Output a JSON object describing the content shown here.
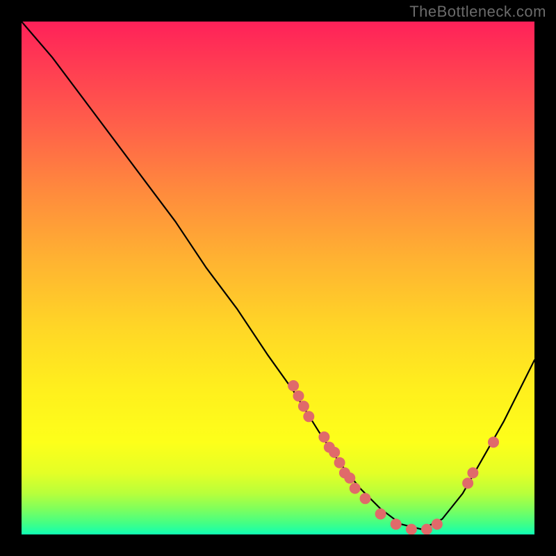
{
  "watermark": "TheBottleneck.com",
  "chart_data": {
    "type": "line",
    "title": "",
    "xlabel": "",
    "ylabel": "",
    "xlim": [
      0,
      100
    ],
    "ylim": [
      0,
      100
    ],
    "curve": [
      {
        "x": 0,
        "y": 100
      },
      {
        "x": 6,
        "y": 93
      },
      {
        "x": 12,
        "y": 85
      },
      {
        "x": 18,
        "y": 77
      },
      {
        "x": 24,
        "y": 69
      },
      {
        "x": 30,
        "y": 61
      },
      {
        "x": 36,
        "y": 52
      },
      {
        "x": 42,
        "y": 44
      },
      {
        "x": 48,
        "y": 35
      },
      {
        "x": 53,
        "y": 28
      },
      {
        "x": 58,
        "y": 20
      },
      {
        "x": 62,
        "y": 14
      },
      {
        "x": 66,
        "y": 9
      },
      {
        "x": 70,
        "y": 5
      },
      {
        "x": 74,
        "y": 2
      },
      {
        "x": 78,
        "y": 1
      },
      {
        "x": 82,
        "y": 3
      },
      {
        "x": 86,
        "y": 8
      },
      {
        "x": 90,
        "y": 15
      },
      {
        "x": 94,
        "y": 22
      },
      {
        "x": 98,
        "y": 30
      },
      {
        "x": 100,
        "y": 34
      }
    ],
    "scatter": [
      {
        "x": 53,
        "y": 29
      },
      {
        "x": 54,
        "y": 27
      },
      {
        "x": 55,
        "y": 25
      },
      {
        "x": 56,
        "y": 23
      },
      {
        "x": 59,
        "y": 19
      },
      {
        "x": 60,
        "y": 17
      },
      {
        "x": 61,
        "y": 16
      },
      {
        "x": 62,
        "y": 14
      },
      {
        "x": 63,
        "y": 12
      },
      {
        "x": 64,
        "y": 11
      },
      {
        "x": 65,
        "y": 9
      },
      {
        "x": 67,
        "y": 7
      },
      {
        "x": 70,
        "y": 4
      },
      {
        "x": 73,
        "y": 2
      },
      {
        "x": 76,
        "y": 1
      },
      {
        "x": 79,
        "y": 1
      },
      {
        "x": 81,
        "y": 2
      },
      {
        "x": 87,
        "y": 10
      },
      {
        "x": 88,
        "y": 12
      },
      {
        "x": 92,
        "y": 18
      }
    ],
    "colors": {
      "curve": "#000000",
      "scatter": "#e06a6a"
    }
  }
}
